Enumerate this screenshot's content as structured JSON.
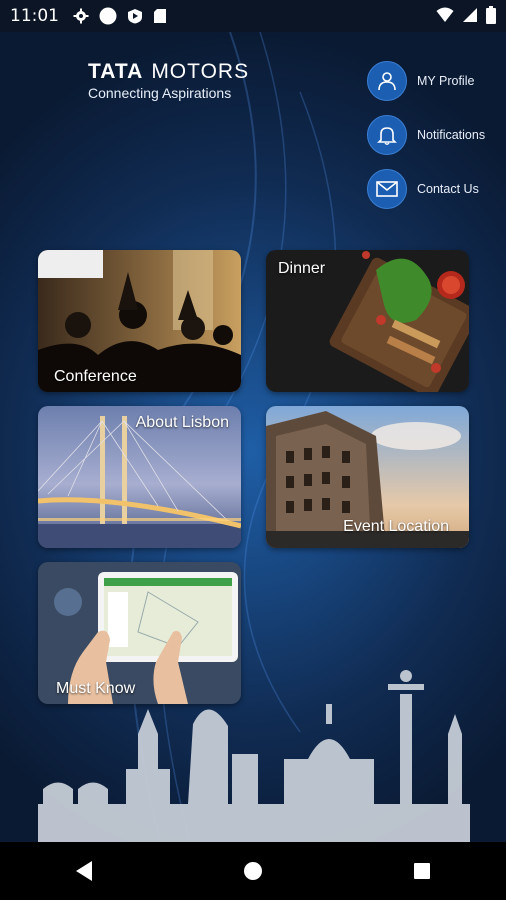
{
  "status": {
    "time": "11:01"
  },
  "brand": {
    "name": "TATA",
    "name2": "MOTORS",
    "tagline": "Connecting Aspirations"
  },
  "quick_links": [
    {
      "label": "MY Profile",
      "icon": "person-icon"
    },
    {
      "label": "Notifications",
      "icon": "bell-icon"
    },
    {
      "label": "Contact Us",
      "icon": "envelope-icon"
    }
  ],
  "tiles": {
    "conference": "Conference",
    "dinner": "Dinner",
    "about_lisbon": "About Lisbon",
    "event_location": "Event Location",
    "must_know": "Must Know"
  },
  "colors": {
    "accent": "#1c5fb2",
    "background": "#102b52"
  }
}
